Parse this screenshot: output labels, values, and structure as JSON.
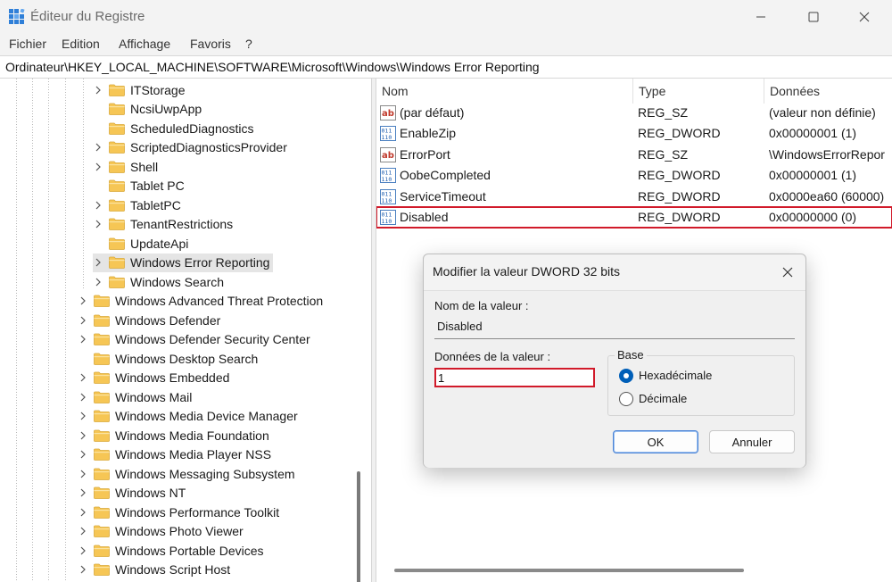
{
  "window": {
    "title": "Éditeur du Registre",
    "icon": "regedit-icon"
  },
  "menu": [
    "Fichier",
    "Edition",
    "Affichage",
    "Favoris",
    "?"
  ],
  "address": "Ordinateur\\HKEY_LOCAL_MACHINE\\SOFTWARE\\Microsoft\\Windows\\Windows Error Reporting",
  "tree": {
    "items": [
      {
        "label": "ITStorage",
        "expandable": true,
        "level": 1
      },
      {
        "label": "NcsiUwpApp",
        "expandable": false,
        "level": 1
      },
      {
        "label": "ScheduledDiagnostics",
        "expandable": false,
        "level": 1
      },
      {
        "label": "ScriptedDiagnosticsProvider",
        "expandable": true,
        "level": 1
      },
      {
        "label": "Shell",
        "expandable": true,
        "level": 1
      },
      {
        "label": "Tablet PC",
        "expandable": false,
        "level": 1
      },
      {
        "label": "TabletPC",
        "expandable": true,
        "level": 1
      },
      {
        "label": "TenantRestrictions",
        "expandable": true,
        "level": 1
      },
      {
        "label": "UpdateApi",
        "expandable": false,
        "level": 1
      },
      {
        "label": "Windows Error Reporting",
        "expandable": true,
        "level": 1,
        "selected": true
      },
      {
        "label": "Windows Search",
        "expandable": true,
        "level": 1
      },
      {
        "label": "Windows Advanced Threat Protection",
        "expandable": true,
        "level": 0
      },
      {
        "label": "Windows Defender",
        "expandable": true,
        "level": 0
      },
      {
        "label": "Windows Defender Security Center",
        "expandable": true,
        "level": 0
      },
      {
        "label": "Windows Desktop Search",
        "expandable": false,
        "level": 0
      },
      {
        "label": "Windows Embedded",
        "expandable": true,
        "level": 0
      },
      {
        "label": "Windows Mail",
        "expandable": true,
        "level": 0
      },
      {
        "label": "Windows Media Device Manager",
        "expandable": true,
        "level": 0
      },
      {
        "label": "Windows Media Foundation",
        "expandable": true,
        "level": 0
      },
      {
        "label": "Windows Media Player NSS",
        "expandable": true,
        "level": 0
      },
      {
        "label": "Windows Messaging Subsystem",
        "expandable": true,
        "level": 0
      },
      {
        "label": "Windows NT",
        "expandable": true,
        "level": 0
      },
      {
        "label": "Windows Performance Toolkit",
        "expandable": true,
        "level": 0
      },
      {
        "label": "Windows Photo Viewer",
        "expandable": true,
        "level": 0
      },
      {
        "label": "Windows Portable Devices",
        "expandable": true,
        "level": 0
      },
      {
        "label": "Windows Script Host",
        "expandable": true,
        "level": 0
      }
    ]
  },
  "list": {
    "columns": [
      "Nom",
      "Type",
      "Données"
    ],
    "rows": [
      {
        "icon": "string-value-icon",
        "name": "(par défaut)",
        "type": "REG_SZ",
        "data": "(valeur non définie)"
      },
      {
        "icon": "dword-value-icon",
        "name": "EnableZip",
        "type": "REG_DWORD",
        "data": "0x00000001 (1)"
      },
      {
        "icon": "string-value-icon",
        "name": "ErrorPort",
        "type": "REG_SZ",
        "data": "\\WindowsErrorRepor"
      },
      {
        "icon": "dword-value-icon",
        "name": "OobeCompleted",
        "type": "REG_DWORD",
        "data": "0x00000001 (1)"
      },
      {
        "icon": "dword-value-icon",
        "name": "ServiceTimeout",
        "type": "REG_DWORD",
        "data": "0x0000ea60 (60000)"
      },
      {
        "icon": "dword-value-icon",
        "name": "Disabled",
        "type": "REG_DWORD",
        "data": "0x00000000 (0)",
        "highlighted": true
      }
    ]
  },
  "dialog": {
    "title": "Modifier la valeur DWORD 32 bits",
    "name_label": "Nom de la valeur :",
    "name_value": "Disabled",
    "data_label": "Données de la valeur :",
    "data_value": "1",
    "base_label": "Base",
    "radio_hex": "Hexadécimale",
    "radio_dec": "Décimale",
    "selected_base": "hex",
    "ok": "OK",
    "cancel": "Annuler"
  },
  "colors": {
    "highlight": "#d11a2a",
    "accent": "#005fb8",
    "folder": "#f6c655"
  }
}
